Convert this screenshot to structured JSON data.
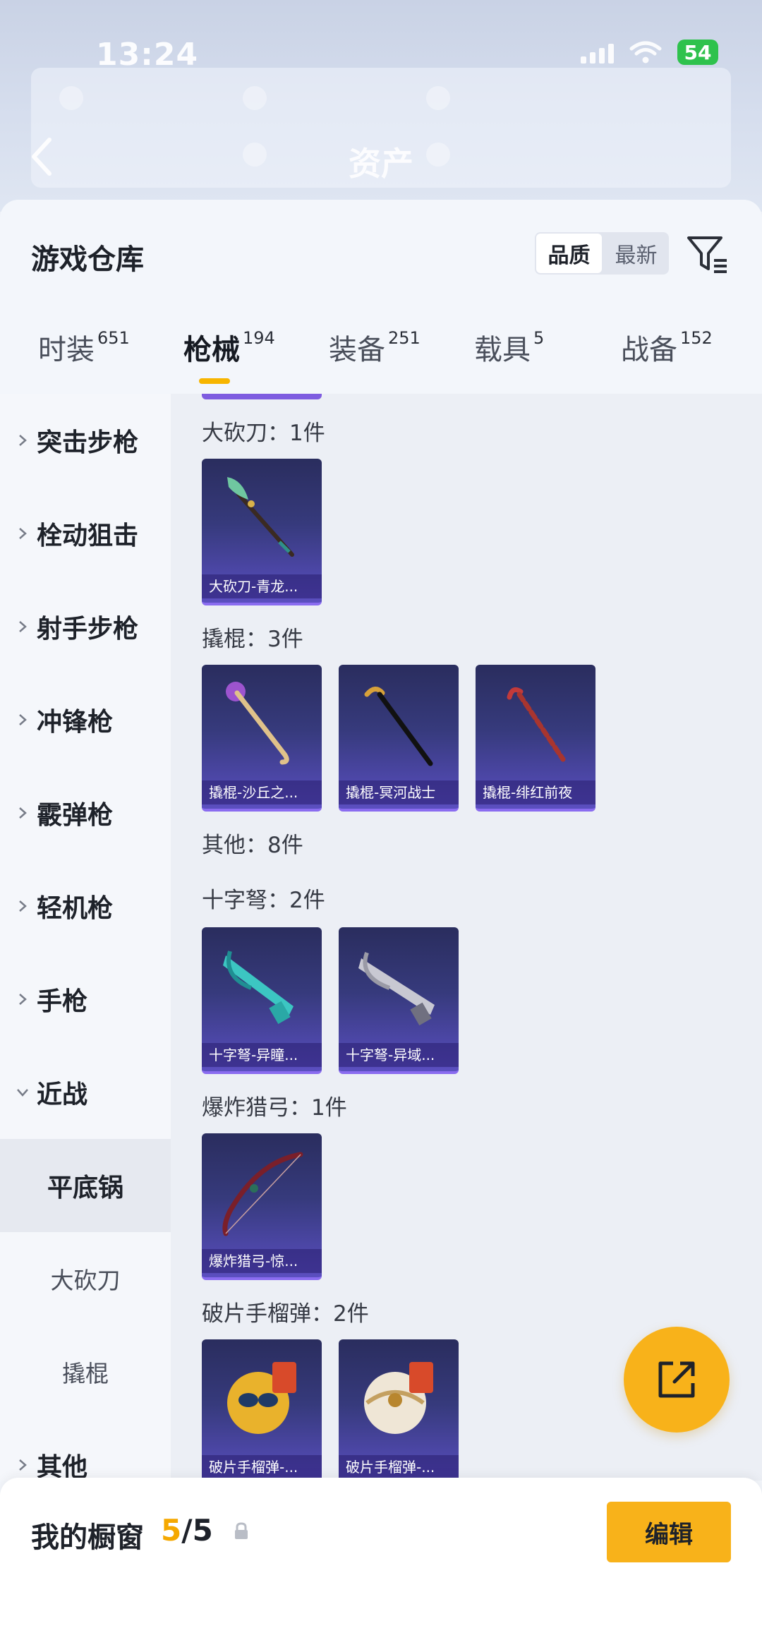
{
  "status_bar": {
    "time": "13:24",
    "battery": "54"
  },
  "header": {
    "title": "资产"
  },
  "warehouse": {
    "title": "游戏仓库",
    "sort_options": [
      "品质",
      "最新"
    ],
    "active_sort": "品质"
  },
  "tabs": [
    {
      "label": "时装",
      "count": "651"
    },
    {
      "label": "枪械",
      "count": "194",
      "active": true
    },
    {
      "label": "装备",
      "count": "251"
    },
    {
      "label": "载具",
      "count": "5"
    },
    {
      "label": "战备",
      "count": "152"
    }
  ],
  "sidebar": {
    "categories": [
      "突击步枪",
      "栓动狙击",
      "射手步枪",
      "冲锋枪",
      "霰弹枪",
      "轻机枪",
      "手枪",
      "近战"
    ],
    "melee_sub": [
      "平底锅",
      "大砍刀",
      "撬棍"
    ],
    "selected_sub": "平底锅",
    "other": "其他"
  },
  "groups": [
    {
      "title": "大砍刀：1件",
      "items": [
        "大砍刀-青龙..."
      ]
    },
    {
      "title": "撬棍：3件",
      "items": [
        "撬棍-沙丘之...",
        "撬棍-冥河战士",
        "撬棍-绯红前夜"
      ]
    },
    {
      "title": "其他：8件",
      "items": []
    },
    {
      "title": "十字弩：2件",
      "items": [
        "十字弩-异瞳...",
        "十字弩-异域..."
      ]
    },
    {
      "title": "爆炸猎弓：1件",
      "items": [
        "爆炸猎弓-惊..."
      ]
    },
    {
      "title": "破片手榴弹：2件",
      "items": [
        "破片手榴弹-...",
        "破片手榴弹-..."
      ]
    }
  ],
  "showcase": {
    "label": "我的橱窗",
    "count": "5",
    "separator": "/",
    "max": "5",
    "edit_label": "编辑"
  },
  "icons": {
    "back": "back-arrow-icon",
    "filter": "filter-icon",
    "share": "share-icon",
    "lock": "lock-icon",
    "chevron_right": "chevron-right-icon",
    "chevron_down": "chevron-down-icon"
  },
  "colors": {
    "accent": "#f8b21a",
    "card_gradient_top": "#2a2d5e",
    "card_gradient_bottom": "#5b4fc0"
  }
}
